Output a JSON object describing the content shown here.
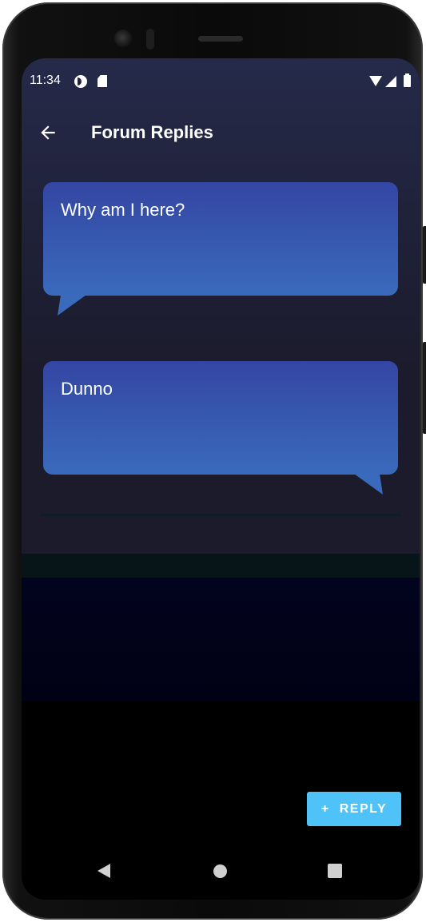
{
  "status_bar": {
    "time": "11:34"
  },
  "app_bar": {
    "title": "Forum Replies",
    "back_icon": "arrow-back-icon"
  },
  "messages": [
    {
      "text": "Why am I here?",
      "tail_side": "left"
    },
    {
      "text": "Dunno",
      "tail_side": "right"
    }
  ],
  "reply_button": {
    "icon": "+",
    "label": "REPLY"
  },
  "colors": {
    "bubble_top": "#3446a3",
    "bubble_bottom": "#3a6abb",
    "reply_button": "#4fc3f7",
    "background_top": "#252a4a"
  },
  "nav_bar": {
    "icons": [
      "nav-back-icon",
      "nav-home-icon",
      "nav-recents-icon"
    ]
  }
}
